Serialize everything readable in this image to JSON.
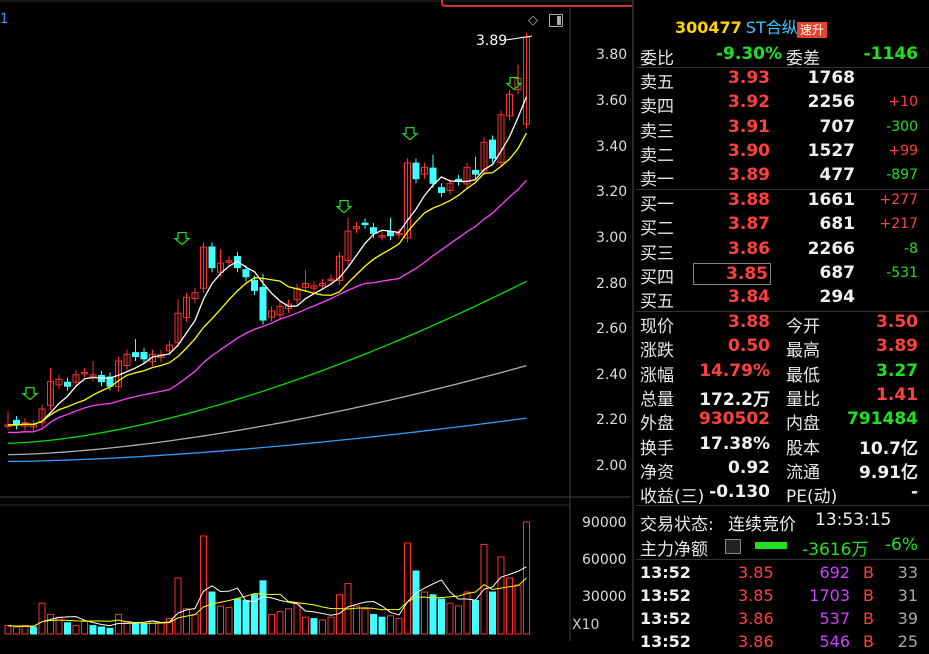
{
  "stock": {
    "code": "300477",
    "name": "ST合纵",
    "badge": "速升"
  },
  "chart": {
    "last_price_label": "3.89",
    "y_ticks": [
      "3.80",
      "3.60",
      "3.40",
      "3.20",
      "3.00",
      "2.80",
      "2.60",
      "2.40",
      "2.20",
      "2.00"
    ],
    "vol_ticks": [
      "90000",
      "60000",
      "30000"
    ],
    "vol_unit": "X10",
    "corner_label": "1",
    "colors": {
      "up": "#ff3030",
      "down": "#40ffff",
      "ma5": "#ffffff",
      "ma10": "#ffff00",
      "ma20": "#ff40ff",
      "ma30": "#00e000",
      "ma60": "#b0b0b0",
      "ma120": "#2aa0ff",
      "marker": "#20e020"
    }
  },
  "quote": {
    "wei_bi": {
      "label": "委比",
      "value": "-9.30%"
    },
    "wei_cha": {
      "label": "委差",
      "value": "-1146"
    },
    "asks": [
      {
        "label": "卖五",
        "price": "3.93",
        "vol": "1768",
        "chg": ""
      },
      {
        "label": "卖四",
        "price": "3.92",
        "vol": "2256",
        "chg": "+10"
      },
      {
        "label": "卖三",
        "price": "3.91",
        "vol": "707",
        "chg": "-300"
      },
      {
        "label": "卖二",
        "price": "3.90",
        "vol": "1527",
        "chg": "+99"
      },
      {
        "label": "卖一",
        "price": "3.89",
        "vol": "477",
        "chg": "-897"
      }
    ],
    "bids": [
      {
        "label": "买一",
        "price": "3.88",
        "vol": "1661",
        "chg": "+277"
      },
      {
        "label": "买二",
        "price": "3.87",
        "vol": "681",
        "chg": "+217"
      },
      {
        "label": "买三",
        "price": "3.86",
        "vol": "2266",
        "chg": "-8"
      },
      {
        "label": "买四",
        "price": "3.85",
        "vol": "687",
        "chg": "-531"
      },
      {
        "label": "买五",
        "price": "3.84",
        "vol": "294",
        "chg": ""
      }
    ],
    "stats": [
      {
        "l1": "现价",
        "v1": "3.88",
        "c1": "red",
        "l2": "今开",
        "v2": "3.50",
        "c2": "red"
      },
      {
        "l1": "涨跌",
        "v1": "0.50",
        "c1": "red",
        "l2": "最高",
        "v2": "3.89",
        "c2": "red"
      },
      {
        "l1": "涨幅",
        "v1": "14.79%",
        "c1": "red",
        "l2": "最低",
        "v2": "3.27",
        "c2": "green"
      },
      {
        "l1": "总量",
        "v1": "172.2万",
        "c1": "white",
        "l2": "量比",
        "v2": "1.41",
        "c2": "red"
      },
      {
        "l1": "外盘",
        "v1": "930502",
        "c1": "red",
        "l2": "内盘",
        "v2": "791484",
        "c2": "green"
      },
      {
        "l1": "换手",
        "v1": "17.38%",
        "c1": "white",
        "l2": "股本",
        "v2": "10.7亿",
        "c2": "white"
      },
      {
        "l1": "净资",
        "v1": "0.92",
        "c1": "white",
        "l2": "流通",
        "v2": "9.91亿",
        "c2": "white"
      },
      {
        "l1": "收益(三)",
        "v1": "-0.130",
        "c1": "white",
        "l2": "PE(动)",
        "v2": "-",
        "c2": "white"
      }
    ],
    "status": {
      "label": "交易状态:",
      "value": "连续竞价",
      "time": "13:53:15"
    },
    "main_flow": {
      "label": "主力净额",
      "value": "-3616万",
      "pct": "-6%"
    },
    "ticks": [
      {
        "time": "13:52",
        "price": "3.85",
        "vol": "692",
        "side": "B",
        "n": "33"
      },
      {
        "time": "13:52",
        "price": "3.85",
        "vol": "1703",
        "side": "B",
        "n": "31"
      },
      {
        "time": "13:52",
        "price": "3.86",
        "vol": "537",
        "side": "B",
        "n": "39"
      },
      {
        "time": "13:52",
        "price": "3.86",
        "vol": "546",
        "side": "B",
        "n": "25"
      }
    ]
  }
}
